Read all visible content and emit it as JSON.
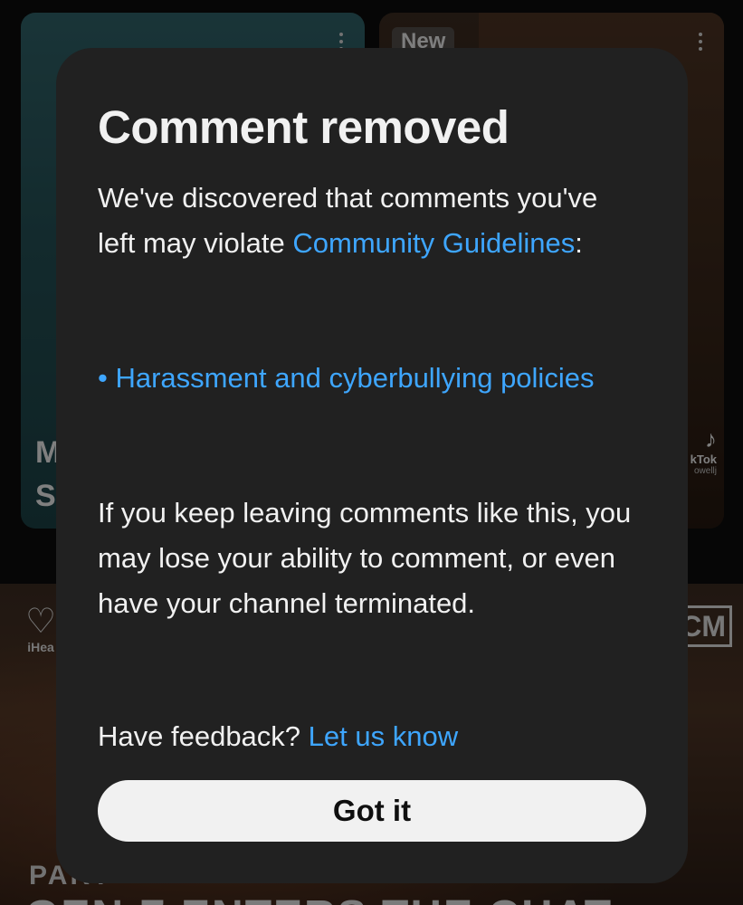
{
  "background": {
    "left_card": {
      "title_fragment": "M\nS"
    },
    "right_card": {
      "badge": "New",
      "watermark_brand": "kTok",
      "watermark_handle": "owellj"
    },
    "video": {
      "logo_text": "iHea",
      "corner_badge": "CM",
      "part_label": "PART",
      "headline_fragment": "GEN Z ENTERS THE CHAT"
    }
  },
  "icons": {
    "kebab": "more-vert-icon",
    "tiktok": "tiktok-note-icon",
    "iheart": "iheart-logo-icon"
  },
  "dialog": {
    "title": "Comment removed",
    "intro_text": "We've discovered that comments you've left may violate ",
    "guidelines_link": "Community Guidelines",
    "intro_colon": ":",
    "policy_link": "• Harassment and cyberbullying policies",
    "warning_text": "If you keep leaving comments like this, you may lose your ability to comment, or even have your channel terminated.",
    "feedback_text": "Have feedback? ",
    "feedback_link": "Let us know",
    "button_label": "Got it"
  },
  "colors": {
    "dialog_bg": "#212121",
    "link": "#3ea6ff",
    "button_bg": "#f1f1f1",
    "text": "#f1f1f1"
  }
}
